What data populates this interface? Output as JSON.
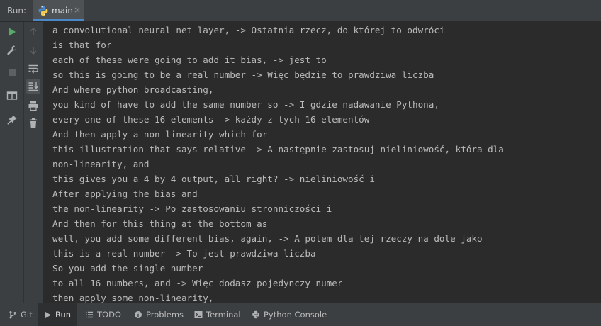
{
  "header": {
    "run_label": "Run:",
    "tab_label": "main",
    "tab_close": "×"
  },
  "console": {
    "lines": [
      "a convolutional neural net layer, -> Ostatnia rzecz, do której to odwróci",
      "is that for",
      "each of these were going to add it bias, -> jest to",
      "so this is going to be a real number -> Więc będzie to prawdziwa liczba",
      "And where python broadcasting,",
      "you kind of have to add the same number so -> I gdzie nadawanie Pythona,",
      "every one of these 16 elements -> każdy z tych 16 elementów",
      "And then apply a non-linearity which for",
      "this illustration that says relative -> A następnie zastosuj nieliniowość, która dla",
      "non-linearity, and",
      "this gives you a 4 by 4 output, all right? -> nieliniowość i",
      "After applying the bias and",
      "the non-linearity -> Po zastosowaniu stronniczości i",
      "And then for this thing at the bottom as",
      "well, you add some different bias, again, -> A potem dla tej rzeczy na dole jako",
      "this is a real number -> To jest prawdziwa liczba",
      "So you add the single number",
      "to all 16 numbers, and -> Więc dodasz pojedynczy numer",
      "then apply some non-linearity,"
    ]
  },
  "bottom_tabs": [
    {
      "label": "Git",
      "icon": "git-branch-icon"
    },
    {
      "label": "Run",
      "icon": "run-play-icon"
    },
    {
      "label": "TODO",
      "icon": "todo-list-icon"
    },
    {
      "label": "Problems",
      "icon": "problems-info-icon"
    },
    {
      "label": "Terminal",
      "icon": "terminal-icon"
    },
    {
      "label": "Python Console",
      "icon": "python-console-icon"
    }
  ],
  "colors": {
    "background": "#2b2b2b",
    "panel": "#3c3f41",
    "text": "#bbbbbb",
    "run_green": "#59a869",
    "accent_blue": "#4a88c7"
  }
}
